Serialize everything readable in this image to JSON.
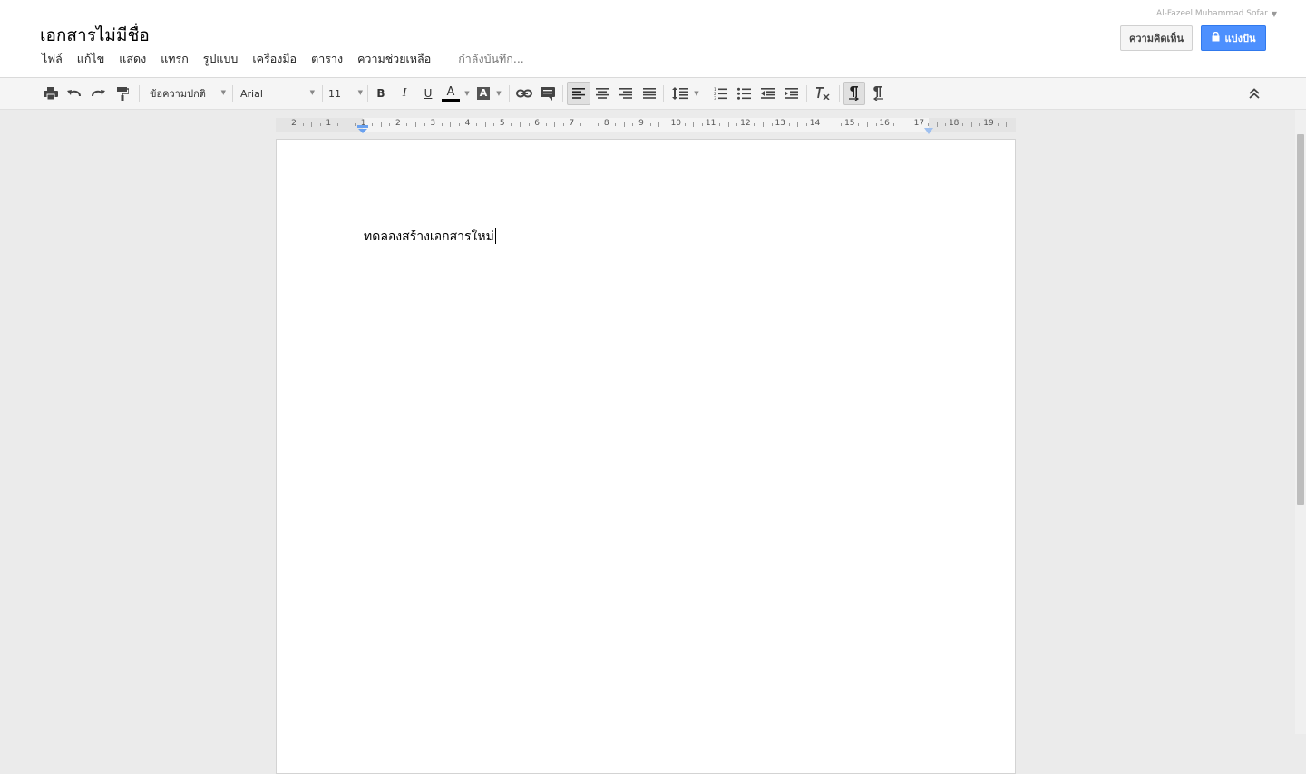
{
  "document": {
    "title": "เอกสารไม่มีชื่อ",
    "body_text": "ทดลองสร้างเอกสารใหม่"
  },
  "menu": {
    "items": [
      {
        "label": "ไฟล์"
      },
      {
        "label": "แก้ไข"
      },
      {
        "label": "แสดง"
      },
      {
        "label": "แทรก"
      },
      {
        "label": "รูปแบบ"
      },
      {
        "label": "เครื่องมือ"
      },
      {
        "label": "ตาราง"
      },
      {
        "label": "ความช่วยเหลือ"
      }
    ],
    "save_status": "กำลังบันทึก..."
  },
  "account": {
    "name": "Al-Fazeel Muhammad Sofar"
  },
  "buttons": {
    "comments": "ความคิดเห็น",
    "share": "แบ่งปัน"
  },
  "toolbar": {
    "style_value": "ข้อความปกติ",
    "font_value": "Arial",
    "size_value": "11",
    "bold": "B",
    "italic": "I",
    "underline": "U",
    "text_color_letter": "A",
    "highlight_letter": "A",
    "text_color": "#000000"
  },
  "ruler": {
    "numbers": [
      "2",
      "1",
      "1",
      "2",
      "3",
      "4",
      "5",
      "6",
      "7",
      "8",
      "9",
      "10",
      "11",
      "12",
      "13",
      "14",
      "15",
      "16",
      "17",
      "18",
      "19"
    ]
  },
  "colors": {
    "share_button": "#4d90fe",
    "background": "#ebebeb"
  }
}
